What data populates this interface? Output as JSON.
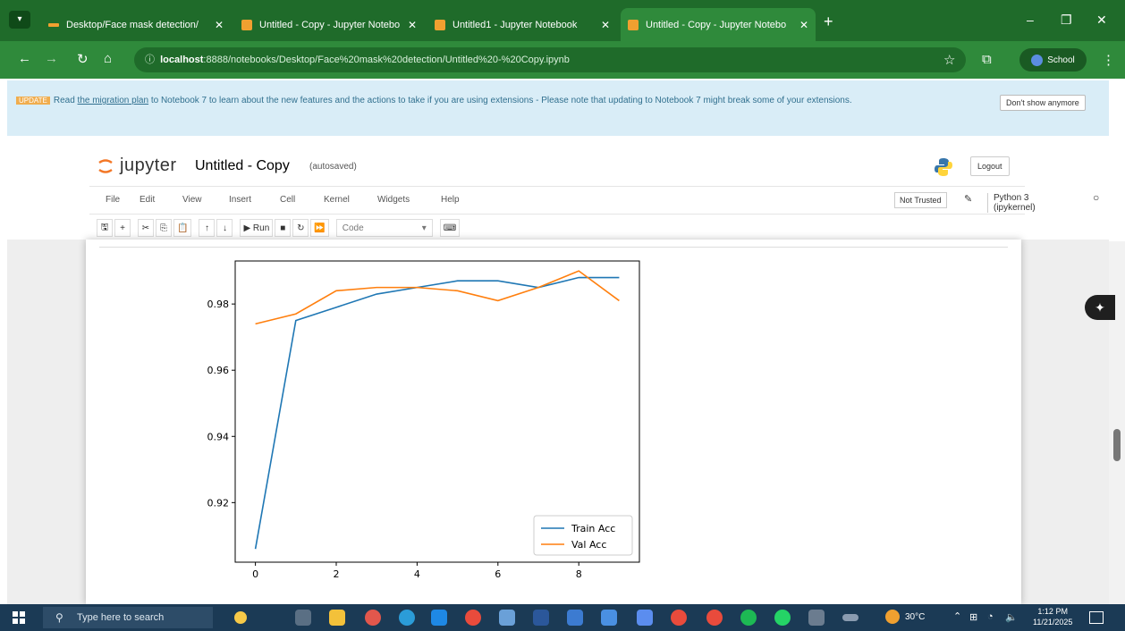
{
  "browser": {
    "tabs": [
      {
        "label": "Desktop/Face mask detection/",
        "color": "#f0a030"
      },
      {
        "label": "Untitled - Copy - Jupyter Notebo",
        "color": "#f0a030"
      },
      {
        "label": "Untitled1 - Jupyter Notebook",
        "color": "#f0a030"
      },
      {
        "label": "Untitled - Copy - Jupyter Notebo",
        "color": "#f0a030"
      }
    ],
    "active_tab": 3,
    "url_host": "localhost",
    "url_rest": ":8888/notebooks/Desktop/Face%20mask%20detection/Untitled%20-%20Copy.ipynb",
    "profile_label": "School",
    "theme_color": "#2f8a3b"
  },
  "banner": {
    "badge": "UPDATE",
    "text_before": "Read ",
    "link_text": "the migration plan",
    "text_after": " to Notebook 7 to learn about the new features and the actions to take if you are using extensions - Please note that updating to Notebook 7 might break some of your extensions.",
    "dismiss_label": "Don't show anymore"
  },
  "jupyter": {
    "logo_text": "jupyter",
    "notebook_title": "Untitled - Copy",
    "autosave": "(autosaved)",
    "logout_label": "Logout",
    "menus": [
      "File",
      "Edit",
      "View",
      "Insert",
      "Cell",
      "Kernel",
      "Widgets",
      "Help"
    ],
    "trusted_label": "Not Trusted",
    "kernel_label": "Python 3 (ipykernel)",
    "run_label": "Run",
    "cell_type": "Code"
  },
  "chart_data": {
    "type": "line",
    "x": [
      0,
      1,
      2,
      3,
      4,
      5,
      6,
      7,
      8,
      9
    ],
    "series": [
      {
        "name": "Train Acc",
        "color": "#1f77b4",
        "values": [
          0.906,
          0.975,
          0.979,
          0.983,
          0.985,
          0.987,
          0.987,
          0.985,
          0.988,
          0.988
        ]
      },
      {
        "name": "Val Acc",
        "color": "#ff7f0e",
        "values": [
          0.974,
          0.977,
          0.984,
          0.985,
          0.985,
          0.984,
          0.981,
          0.985,
          0.99,
          0.981
        ]
      }
    ],
    "xticks": [
      0,
      2,
      4,
      6,
      8
    ],
    "yticks": [
      0.92,
      0.94,
      0.96,
      0.98
    ],
    "xlim": [
      -0.5,
      9.5
    ],
    "ylim": [
      0.902,
      0.993
    ],
    "legend": "lower-right",
    "grid": false
  },
  "taskbar": {
    "search_placeholder": "Type here to search",
    "weather": "30°C",
    "time": "1:12 PM",
    "date": "11/21/2025"
  }
}
